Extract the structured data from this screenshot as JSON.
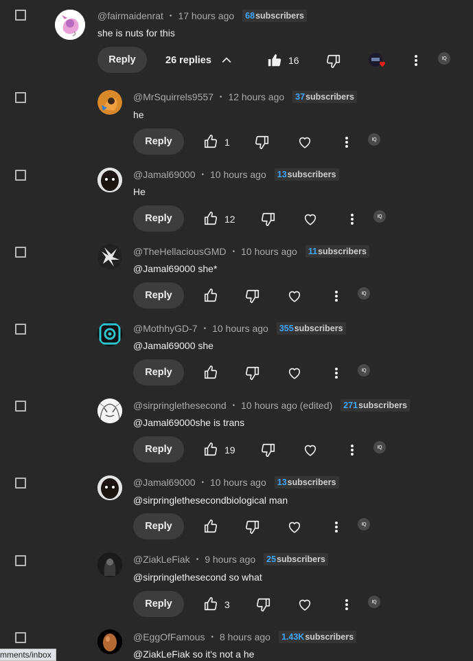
{
  "parent": {
    "author": "@fairmaidenrat",
    "time": "17 hours ago",
    "subs_num": "68",
    "subs_label": "subscribers",
    "text": "she is nuts for this",
    "reply_label": "Reply",
    "replies_label": "26 replies",
    "likes": "16"
  },
  "replies": [
    {
      "author": "@MrSquirrels9557",
      "time": "12 hours ago",
      "subs_num": "37",
      "subs_label": "subscribers",
      "text": "he",
      "reply_label": "Reply",
      "likes": "1",
      "avatar": "squirrel"
    },
    {
      "author": "@Jamal69000",
      "time": "10 hours ago",
      "subs_num": "13",
      "subs_label": "subscribers",
      "text": "He",
      "reply_label": "Reply",
      "likes": "12",
      "avatar": "face"
    },
    {
      "author": "@TheHellaciousGMD",
      "time": "10 hours ago",
      "subs_num": "11",
      "subs_label": "subscribers",
      "text": "@Jamal69000 she*",
      "reply_label": "Reply",
      "likes": "",
      "avatar": "white-splash"
    },
    {
      "author": "@MothhyGD-7",
      "time": "10 hours ago",
      "subs_num": "355",
      "subs_label": "subscribers",
      "text": "@Jamal69000 she",
      "reply_label": "Reply",
      "likes": "",
      "avatar": "cyan-ring"
    },
    {
      "author": "@sirpringlethesecond",
      "time": "10 hours ago (edited)",
      "subs_num": "271",
      "subs_label": "subscribers",
      "text": "@Jamal69000she is trans",
      "reply_label": "Reply",
      "likes": "19",
      "avatar": "manga"
    },
    {
      "author": "@Jamal69000",
      "time": "10 hours ago",
      "subs_num": "13",
      "subs_label": "subscribers",
      "text": "@sirpringlethesecondbiological man",
      "reply_label": "Reply",
      "likes": "",
      "avatar": "face"
    },
    {
      "author": "@ZiakLeFiak",
      "time": "9 hours ago",
      "subs_num": "25",
      "subs_label": "subscribers",
      "text": "@sirpringlethesecond so what",
      "reply_label": "Reply",
      "likes": "3",
      "avatar": "dark-figure"
    },
    {
      "author": "@EggOfFamous",
      "time": "8 hours ago",
      "subs_num": "1.43K",
      "subs_label": "subscribers",
      "text": "@ZiakLeFiak so it's not a he",
      "reply_label": "",
      "likes": "",
      "avatar": "egg"
    }
  ],
  "ext_badge": "IQ",
  "status_url": "mments/inbox",
  "colors": {
    "background": "#282828",
    "link": "#3ea6ff",
    "button": "#3d3d3d",
    "heart": "#e62117"
  },
  "icons": [
    "checkbox",
    "like-icon",
    "dislike-icon",
    "heart-icon",
    "more-vert-icon",
    "chevron-up-icon",
    "extension-icon"
  ]
}
